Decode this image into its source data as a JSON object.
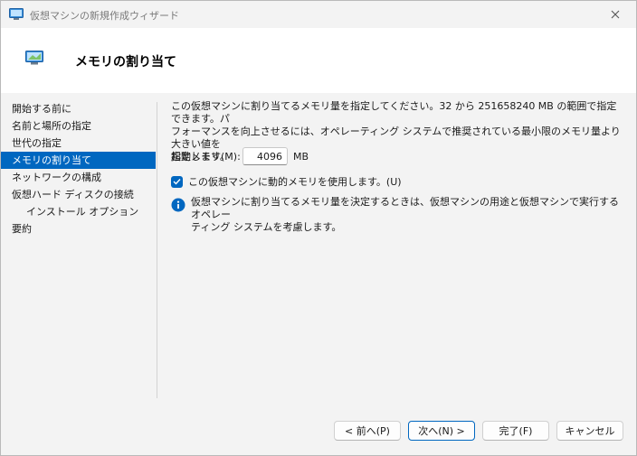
{
  "window": {
    "title": "仮想マシンの新規作成ウィザード",
    "accent_color": "#0067c0"
  },
  "header": {
    "title": "メモリの割り当て"
  },
  "nav": {
    "items": [
      {
        "label": "開始する前に"
      },
      {
        "label": "名前と場所の指定"
      },
      {
        "label": "世代の指定"
      },
      {
        "label": "メモリの割り当て",
        "selected": true
      },
      {
        "label": "ネットワークの構成"
      },
      {
        "label": "仮想ハード ディスクの接続"
      },
      {
        "label": "インストール オプション",
        "indent": true
      },
      {
        "label": "要約"
      }
    ]
  },
  "main": {
    "description_line1": "この仮想マシンに割り当てるメモリ量を指定してください。32 から 251658240 MB の範囲で指定できます。パ",
    "description_line2": "フォーマンスを向上させるには、オペレーティング システムで推奨されている最小限のメモリ量より大きい値を",
    "description_line3": "指定します。",
    "startup_memory_label": "起動メモリ(M):",
    "startup_memory_value": "4096",
    "startup_memory_unit": "MB",
    "dynamic_memory_label": "この仮想マシンに動的メモリを使用します。(U)",
    "dynamic_memory_checked": true,
    "info_line1": "仮想マシンに割り当てるメモリ量を決定するときは、仮想マシンの用途と仮想マシンで実行するオペレー",
    "info_line2": "ティング システムを考慮します。"
  },
  "footer": {
    "back_label": "< 前へ(P)",
    "next_label": "次へ(N) >",
    "finish_label": "完了(F)",
    "cancel_label": "キャンセル"
  }
}
